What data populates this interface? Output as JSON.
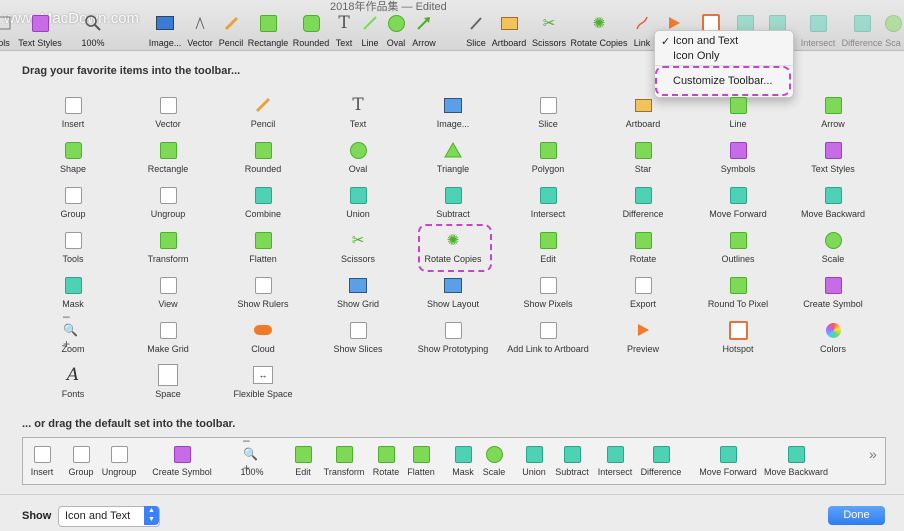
{
  "window": {
    "title": "2018年作品集 — Edited",
    "watermark": "www.MacDown.com"
  },
  "toolbar": {
    "items": [
      {
        "label": "ols",
        "icon": "tools-icon"
      },
      {
        "label": "Text Styles",
        "icon": "text-styles-icon"
      },
      {
        "label": "100%",
        "icon": "zoom-icon"
      },
      {
        "label": "Image...",
        "icon": "image-icon"
      },
      {
        "label": "Vector",
        "icon": "vector-icon"
      },
      {
        "label": "Pencil",
        "icon": "pencil-icon"
      },
      {
        "label": "Rectangle",
        "icon": "rectangle-icon"
      },
      {
        "label": "Rounded",
        "icon": "rounded-icon"
      },
      {
        "label": "Text",
        "icon": "text-icon"
      },
      {
        "label": "Line",
        "icon": "line-icon"
      },
      {
        "label": "Oval",
        "icon": "oval-icon"
      },
      {
        "label": "Arrow",
        "icon": "arrow-icon"
      },
      {
        "label": "Slice",
        "icon": "slice-icon"
      },
      {
        "label": "Artboard",
        "icon": "artboard-icon"
      },
      {
        "label": "Scissors",
        "icon": "scissors-icon"
      },
      {
        "label": "Rotate Copies",
        "icon": "rotate-copies-icon"
      },
      {
        "label": "Link",
        "icon": "link-icon"
      },
      {
        "label": "",
        "icon": "preview-icon"
      },
      {
        "label": "",
        "icon": "hotspot-icon"
      },
      {
        "label": "",
        "icon": "union-icon"
      },
      {
        "label": "t",
        "icon": "subtract-icon"
      },
      {
        "label": "Intersect",
        "icon": "intersect-icon"
      },
      {
        "label": "Difference",
        "icon": "difference-icon"
      },
      {
        "label": "Sca",
        "icon": "scale-icon"
      }
    ]
  },
  "menu": {
    "items": [
      "Icon and Text",
      "Icon Only",
      "Customize Toolbar..."
    ],
    "checked": "Icon and Text"
  },
  "sheet": {
    "heading": "Drag your favorite items into the toolbar...",
    "items": [
      "Insert",
      "Vector",
      "Pencil",
      "Text",
      "Image...",
      "Slice",
      "Artboard",
      "Line",
      "Arrow",
      "Shape",
      "Rectangle",
      "Rounded",
      "Oval",
      "Triangle",
      "Polygon",
      "Star",
      "Symbols",
      "Text Styles",
      "Group",
      "Ungroup",
      "Combine",
      "Union",
      "Subtract",
      "Intersect",
      "Difference",
      "Move Forward",
      "Move Backward",
      "Tools",
      "Transform",
      "Flatten",
      "Scissors",
      "Rotate Copies",
      "Edit",
      "Rotate",
      "Outlines",
      "Scale",
      "Mask",
      "View",
      "Show Rulers",
      "Show Grid",
      "Show Layout",
      "Show Pixels",
      "Export",
      "Round To Pixel",
      "Create Symbol",
      "Zoom",
      "Make Grid",
      "Cloud",
      "Show Slices",
      "Show Prototyping",
      "Add Link to Artboard",
      "Preview",
      "Hotspot",
      "Colors",
      "Fonts",
      "Space",
      "Flexible Space"
    ],
    "default_heading": "... or drag the default set into the toolbar.",
    "default_items": [
      "Insert",
      "Group",
      "Ungroup",
      "Create Symbol",
      "100%",
      "Edit",
      "Transform",
      "Rotate",
      "Flatten",
      "Mask",
      "Scale",
      "Union",
      "Subtract",
      "Intersect",
      "Difference",
      "Move Forward",
      "Move Backward"
    ]
  },
  "footer": {
    "show_label": "Show",
    "show_value": "Icon and Text",
    "done_label": "Done"
  },
  "colors": {
    "accent": "#2f7cf0",
    "highlight": "#c545c8",
    "green": "#7ed957",
    "teal": "#4fd1b5"
  }
}
